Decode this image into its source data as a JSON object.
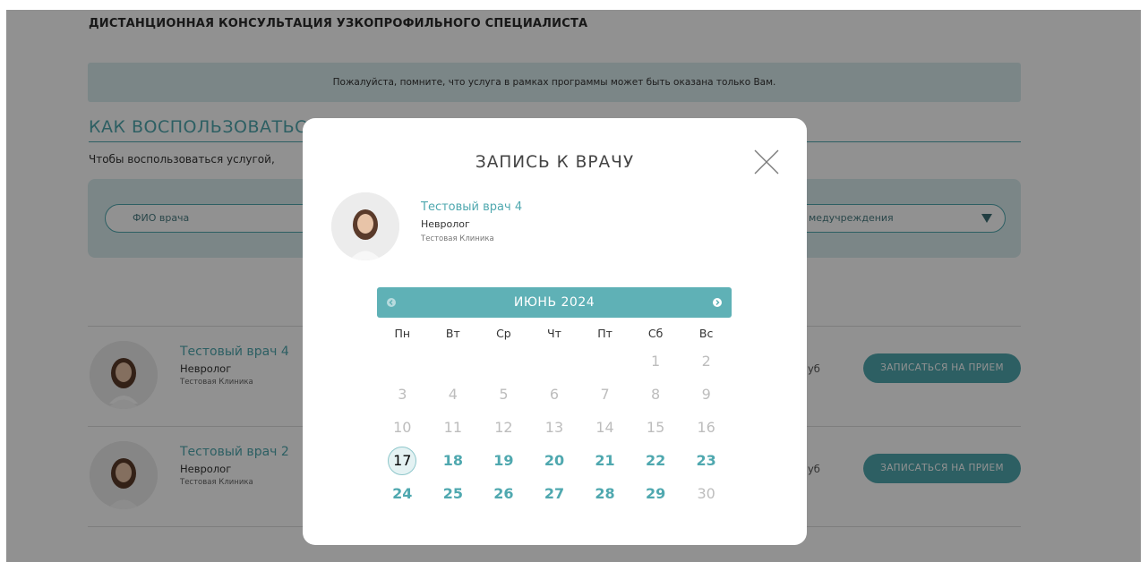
{
  "page": {
    "service_title": "ДИСТАНЦИОННАЯ КОНСУЛЬТАЦИЯ УЗКОПРОФИЛЬНОГО СПЕЦИАЛИСТА",
    "notice": "Пожалуйста, помните, что услуга в рамках программы может быть оказана только Вам.",
    "how_title": "КАК ВОСПОЛЬЗОВАТЬС",
    "how_text": "Чтобы воспользоваться услугой,",
    "filter_doctor_placeholder": "ФИО врача",
    "filter_clinic_label": "медучреждения",
    "doctors": [
      {
        "name": "Тестовый врач 4",
        "specialty": "Невролог",
        "clinic": "Тестовая Клиника",
        "price_cut": "уб",
        "book_label": "ЗАПИСАТЬСЯ НА ПРИЕМ"
      },
      {
        "name": "Тестовый врач 2",
        "specialty": "Невролог",
        "clinic": "Тестовая Клиника",
        "price_cut": "уб",
        "book_label": "ЗАПИСАТЬСЯ НА ПРИЕМ"
      }
    ]
  },
  "modal": {
    "title": "ЗАПИСЬ К ВРАЧУ",
    "close_icon": "close-icon",
    "doctor": {
      "name": "Тестовый врач 4",
      "specialty": "Невролог",
      "clinic": "Тестовая Клиника"
    },
    "calendar": {
      "month_label": "ИЮНЬ 2024",
      "prev_icon": "chevron-left-icon",
      "next_icon": "chevron-right-icon",
      "weekdays": [
        "Пн",
        "Вт",
        "Ср",
        "Чт",
        "Пт",
        "Сб",
        "Вс"
      ],
      "weeks": [
        [
          {
            "d": "",
            "s": "empty"
          },
          {
            "d": "",
            "s": "empty"
          },
          {
            "d": "",
            "s": "empty"
          },
          {
            "d": "",
            "s": "empty"
          },
          {
            "d": "",
            "s": "empty"
          },
          {
            "d": "1",
            "s": "off"
          },
          {
            "d": "2",
            "s": "off"
          }
        ],
        [
          {
            "d": "3",
            "s": "off"
          },
          {
            "d": "4",
            "s": "off"
          },
          {
            "d": "5",
            "s": "off"
          },
          {
            "d": "6",
            "s": "off"
          },
          {
            "d": "7",
            "s": "off"
          },
          {
            "d": "8",
            "s": "off"
          },
          {
            "d": "9",
            "s": "off"
          }
        ],
        [
          {
            "d": "10",
            "s": "off"
          },
          {
            "d": "11",
            "s": "off"
          },
          {
            "d": "12",
            "s": "off"
          },
          {
            "d": "13",
            "s": "off"
          },
          {
            "d": "14",
            "s": "off"
          },
          {
            "d": "15",
            "s": "off"
          },
          {
            "d": "16",
            "s": "off"
          }
        ],
        [
          {
            "d": "17",
            "s": "today"
          },
          {
            "d": "18",
            "s": "on"
          },
          {
            "d": "19",
            "s": "on"
          },
          {
            "d": "20",
            "s": "on"
          },
          {
            "d": "21",
            "s": "on"
          },
          {
            "d": "22",
            "s": "on"
          },
          {
            "d": "23",
            "s": "on"
          }
        ],
        [
          {
            "d": "24",
            "s": "on"
          },
          {
            "d": "25",
            "s": "on"
          },
          {
            "d": "26",
            "s": "on"
          },
          {
            "d": "27",
            "s": "on"
          },
          {
            "d": "28",
            "s": "on"
          },
          {
            "d": "29",
            "s": "on"
          },
          {
            "d": "30",
            "s": "off"
          }
        ]
      ]
    }
  },
  "colors": {
    "accent": "#4fa8af",
    "calendar_header": "#5fb1b6",
    "panel_bg": "#d9ecee",
    "disabled_day": "#bdbdbd"
  }
}
